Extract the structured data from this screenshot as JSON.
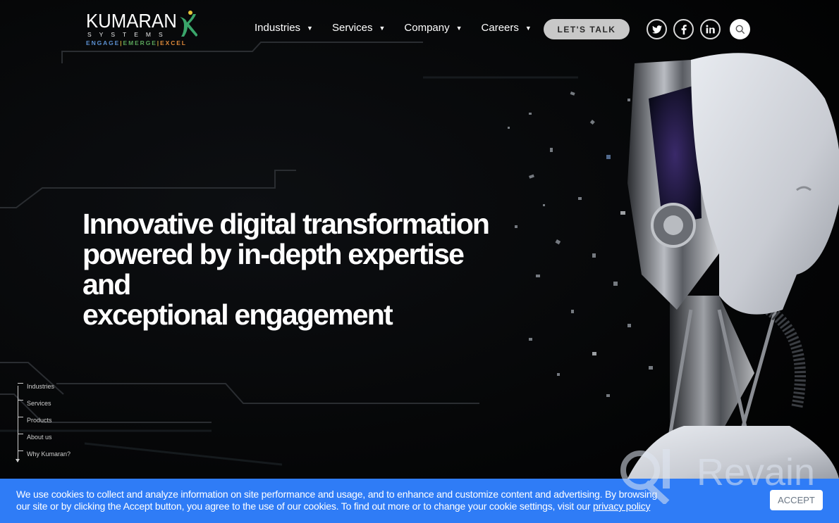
{
  "brand": {
    "name": "KUMARAN",
    "subtitle": "SYSTEMS",
    "tagline": {
      "engage": "ENGAGE",
      "emerge": "EMERGE",
      "excel": "EXCEL",
      "separator": "|"
    },
    "colors": {
      "engage": "#5b8fd0",
      "emerge": "#5aa55a",
      "excel": "#e08a3a",
      "k_green": "#3aa56a",
      "k_dot": "#e6c53a"
    }
  },
  "nav": {
    "items": [
      {
        "label": "Industries",
        "caret": "▼"
      },
      {
        "label": "Services",
        "caret": "▼"
      },
      {
        "label": "Company",
        "caret": "▼"
      },
      {
        "label": "Careers",
        "caret": "▼"
      }
    ],
    "cta_label": "LET'S TALK",
    "social": [
      {
        "name": "twitter-icon",
        "glyph": "t"
      },
      {
        "name": "facebook-icon",
        "glyph": "f"
      },
      {
        "name": "linkedin-icon",
        "glyph": "in"
      }
    ]
  },
  "hero": {
    "headline_lines": [
      "Innovative digital transformation",
      "powered by in-depth expertise and",
      "exceptional engagement"
    ]
  },
  "side_nav": {
    "items": [
      "Industries",
      "Services",
      "Products",
      "About us",
      "Why Kumaran?"
    ]
  },
  "cookie": {
    "line1_prefix": "We use cookies to collect and analyze information on site performance and usage, and to enhance and customize content and advertising. By browsing",
    "line2": "our site or by clicking the Accept button, you agree to the use of our cookies. To find out more or to change your cookie settings, visit our ",
    "link_label": "privacy policy",
    "accept_label": "ACCEPT",
    "background": "#2f7cf6"
  },
  "watermark": {
    "text": "Revain"
  }
}
